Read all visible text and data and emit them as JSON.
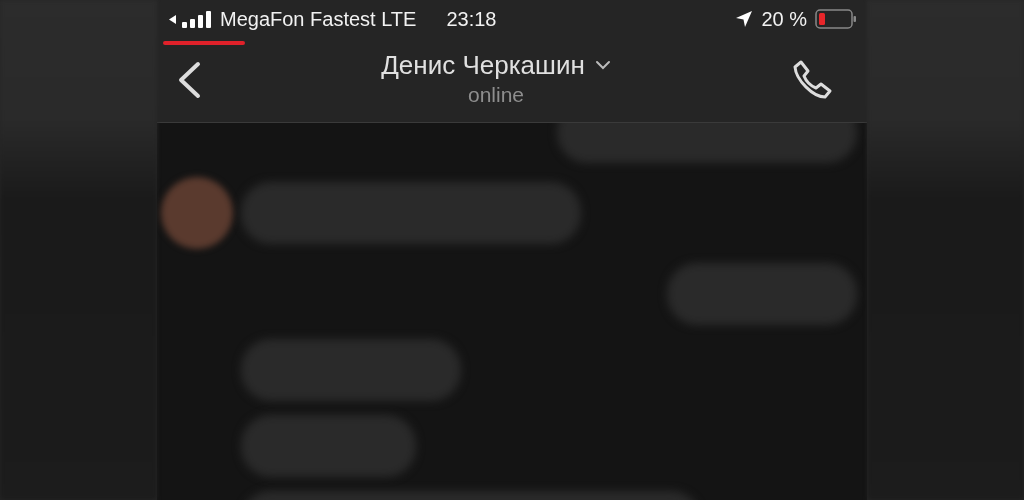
{
  "status_bar": {
    "carrier": "MegaFon Fastest LTE",
    "time": "23:18",
    "battery": "20 %"
  },
  "header": {
    "title": "Денис Черкашин",
    "status": "online"
  },
  "messages": [
    {
      "kind": "outgoing",
      "avatar": false
    },
    {
      "kind": "incoming",
      "avatar": true
    },
    {
      "kind": "outgoing",
      "avatar": false
    },
    {
      "kind": "incoming",
      "avatar": false
    },
    {
      "kind": "incoming",
      "avatar": false
    },
    {
      "kind": "incoming",
      "avatar": false
    }
  ]
}
